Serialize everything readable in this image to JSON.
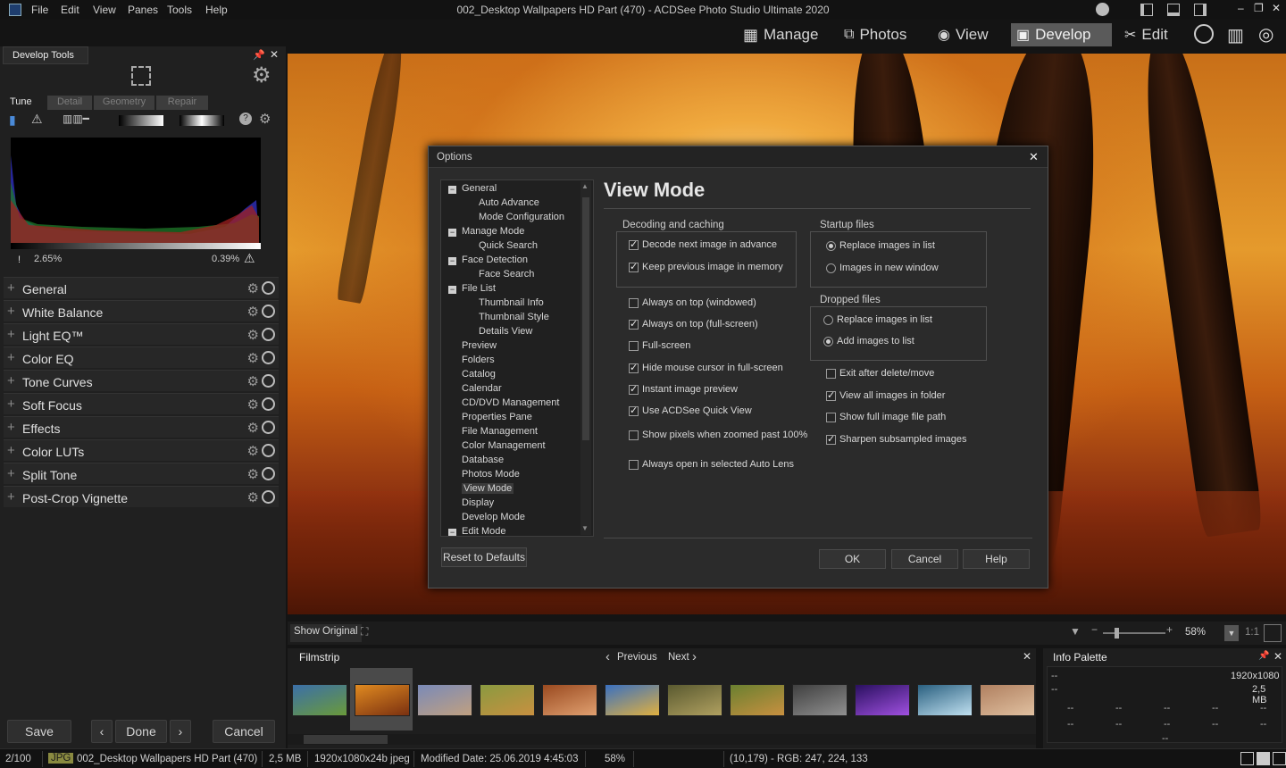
{
  "app": {
    "title": "002_Desktop Wallpapers  HD Part (470) - ACDSee Photo Studio Ultimate 2020",
    "menu": [
      "File",
      "Edit",
      "View",
      "Panes",
      "Tools",
      "Help"
    ]
  },
  "modes": {
    "manage": "Manage",
    "photos": "Photos",
    "view": "View",
    "develop": "Develop",
    "edit": "Edit"
  },
  "left": {
    "title": "Develop Tools",
    "tabs": [
      "Tune",
      "Detail",
      "Geometry",
      "Repair"
    ],
    "hist_low": "2.65%",
    "hist_high": "0.39%",
    "tools": [
      "General",
      "White Balance",
      "Light EQ™",
      "Color EQ",
      "Tone Curves",
      "Soft Focus",
      "Effects",
      "Color LUTs",
      "Split Tone",
      "Post-Crop Vignette"
    ],
    "save": "Save",
    "done": "Done",
    "cancel": "Cancel"
  },
  "dialog": {
    "title": "Options",
    "heading": "View Mode",
    "tree": [
      {
        "label": "General",
        "level": 0,
        "exp": true
      },
      {
        "label": "Auto Advance",
        "level": 1
      },
      {
        "label": "Mode Configuration",
        "level": 1
      },
      {
        "label": "Manage Mode",
        "level": 0,
        "exp": true
      },
      {
        "label": "Quick Search",
        "level": 1
      },
      {
        "label": "Face Detection",
        "level": 0,
        "exp": true
      },
      {
        "label": "Face Search",
        "level": 1
      },
      {
        "label": "File List",
        "level": 0,
        "exp": true
      },
      {
        "label": "Thumbnail Info",
        "level": 1
      },
      {
        "label": "Thumbnail Style",
        "level": 1
      },
      {
        "label": "Details View",
        "level": 1
      },
      {
        "label": "Preview",
        "level": 0
      },
      {
        "label": "Folders",
        "level": 0
      },
      {
        "label": "Catalog",
        "level": 0
      },
      {
        "label": "Calendar",
        "level": 0
      },
      {
        "label": "CD/DVD Management",
        "level": 0
      },
      {
        "label": "Properties Pane",
        "level": 0
      },
      {
        "label": "File Management",
        "level": 0
      },
      {
        "label": "Color Management",
        "level": 0
      },
      {
        "label": "Database",
        "level": 0
      },
      {
        "label": "Photos Mode",
        "level": 0
      },
      {
        "label": "View Mode",
        "level": 0,
        "sel": true
      },
      {
        "label": "Display",
        "level": 0
      },
      {
        "label": "Develop Mode",
        "level": 0
      },
      {
        "label": "Edit Mode",
        "level": 0,
        "exp": true
      }
    ],
    "decoding": {
      "title": "Decoding and caching",
      "opts": [
        {
          "label": "Decode next image in advance",
          "on": true
        },
        {
          "label": "Keep previous image in memory",
          "on": true
        }
      ]
    },
    "startup": {
      "title": "Startup files",
      "opts": [
        {
          "label": "Replace images in list",
          "on": true
        },
        {
          "label": "Images in new window",
          "on": false
        }
      ]
    },
    "dropped": {
      "title": "Dropped files",
      "opts": [
        {
          "label": "Replace images in list",
          "on": false
        },
        {
          "label": "Add images to list",
          "on": true
        }
      ]
    },
    "left_opts": [
      {
        "label": "Always on top (windowed)",
        "on": false
      },
      {
        "label": "Always on top (full-screen)",
        "on": true
      },
      {
        "label": "Full-screen",
        "on": false
      },
      {
        "label": "Hide mouse cursor in full-screen",
        "on": true
      },
      {
        "label": "Instant image preview",
        "on": true
      },
      {
        "label": "Use ACDSee Quick View",
        "on": true
      },
      {
        "label": "Show pixels when zoomed past 100%",
        "on": false
      },
      {
        "label": "Always open in selected Auto Lens",
        "on": false
      }
    ],
    "right_opts": [
      {
        "label": "Exit after delete/move",
        "on": false
      },
      {
        "label": "View all images in folder",
        "on": true
      },
      {
        "label": "Show full image file path",
        "on": false
      },
      {
        "label": "Sharpen subsampled images",
        "on": true
      }
    ],
    "reset": "Reset to Defaults",
    "ok": "OK",
    "cancel": "Cancel",
    "help": "Help"
  },
  "viewbar": {
    "show_original": "Show Original",
    "zoom": "58%",
    "ratio": "1:1"
  },
  "filmstrip": {
    "title": "Filmstrip",
    "previous": "Previous",
    "next": "Next",
    "thumb_colors": [
      [
        "#3b6fa8",
        "#6a9a3a"
      ],
      [
        "#e08a20",
        "#7a3010"
      ],
      [
        "#7a8ab8",
        "#c0a080"
      ],
      [
        "#8a9a40",
        "#c89040"
      ],
      [
        "#9a4a20",
        "#e0a070"
      ],
      [
        "#3a70c0",
        "#e0b040"
      ],
      [
        "#5a5a30",
        "#b0a060"
      ],
      [
        "#6a8030",
        "#c89040"
      ],
      [
        "#404040",
        "#909090"
      ],
      [
        "#2a1060",
        "#a050e0"
      ],
      [
        "#2a6080",
        "#c0e0f0"
      ],
      [
        "#b08060",
        "#e0c0a0"
      ]
    ]
  },
  "info": {
    "title": "Info Palette",
    "dims": "1920x1080",
    "size": "2,5 MB",
    "dash": "--"
  },
  "status": {
    "index": "2/100",
    "type": "JPG",
    "file": "002_Desktop Wallpapers  HD Part (470)",
    "size": "2,5 MB",
    "meta": "1920x1080x24b jpeg",
    "modified": "Modified Date: 25.06.2019 4:45:03",
    "zoom": "58%",
    "pixel": "(10,179) - RGB: 247, 224, 133"
  }
}
